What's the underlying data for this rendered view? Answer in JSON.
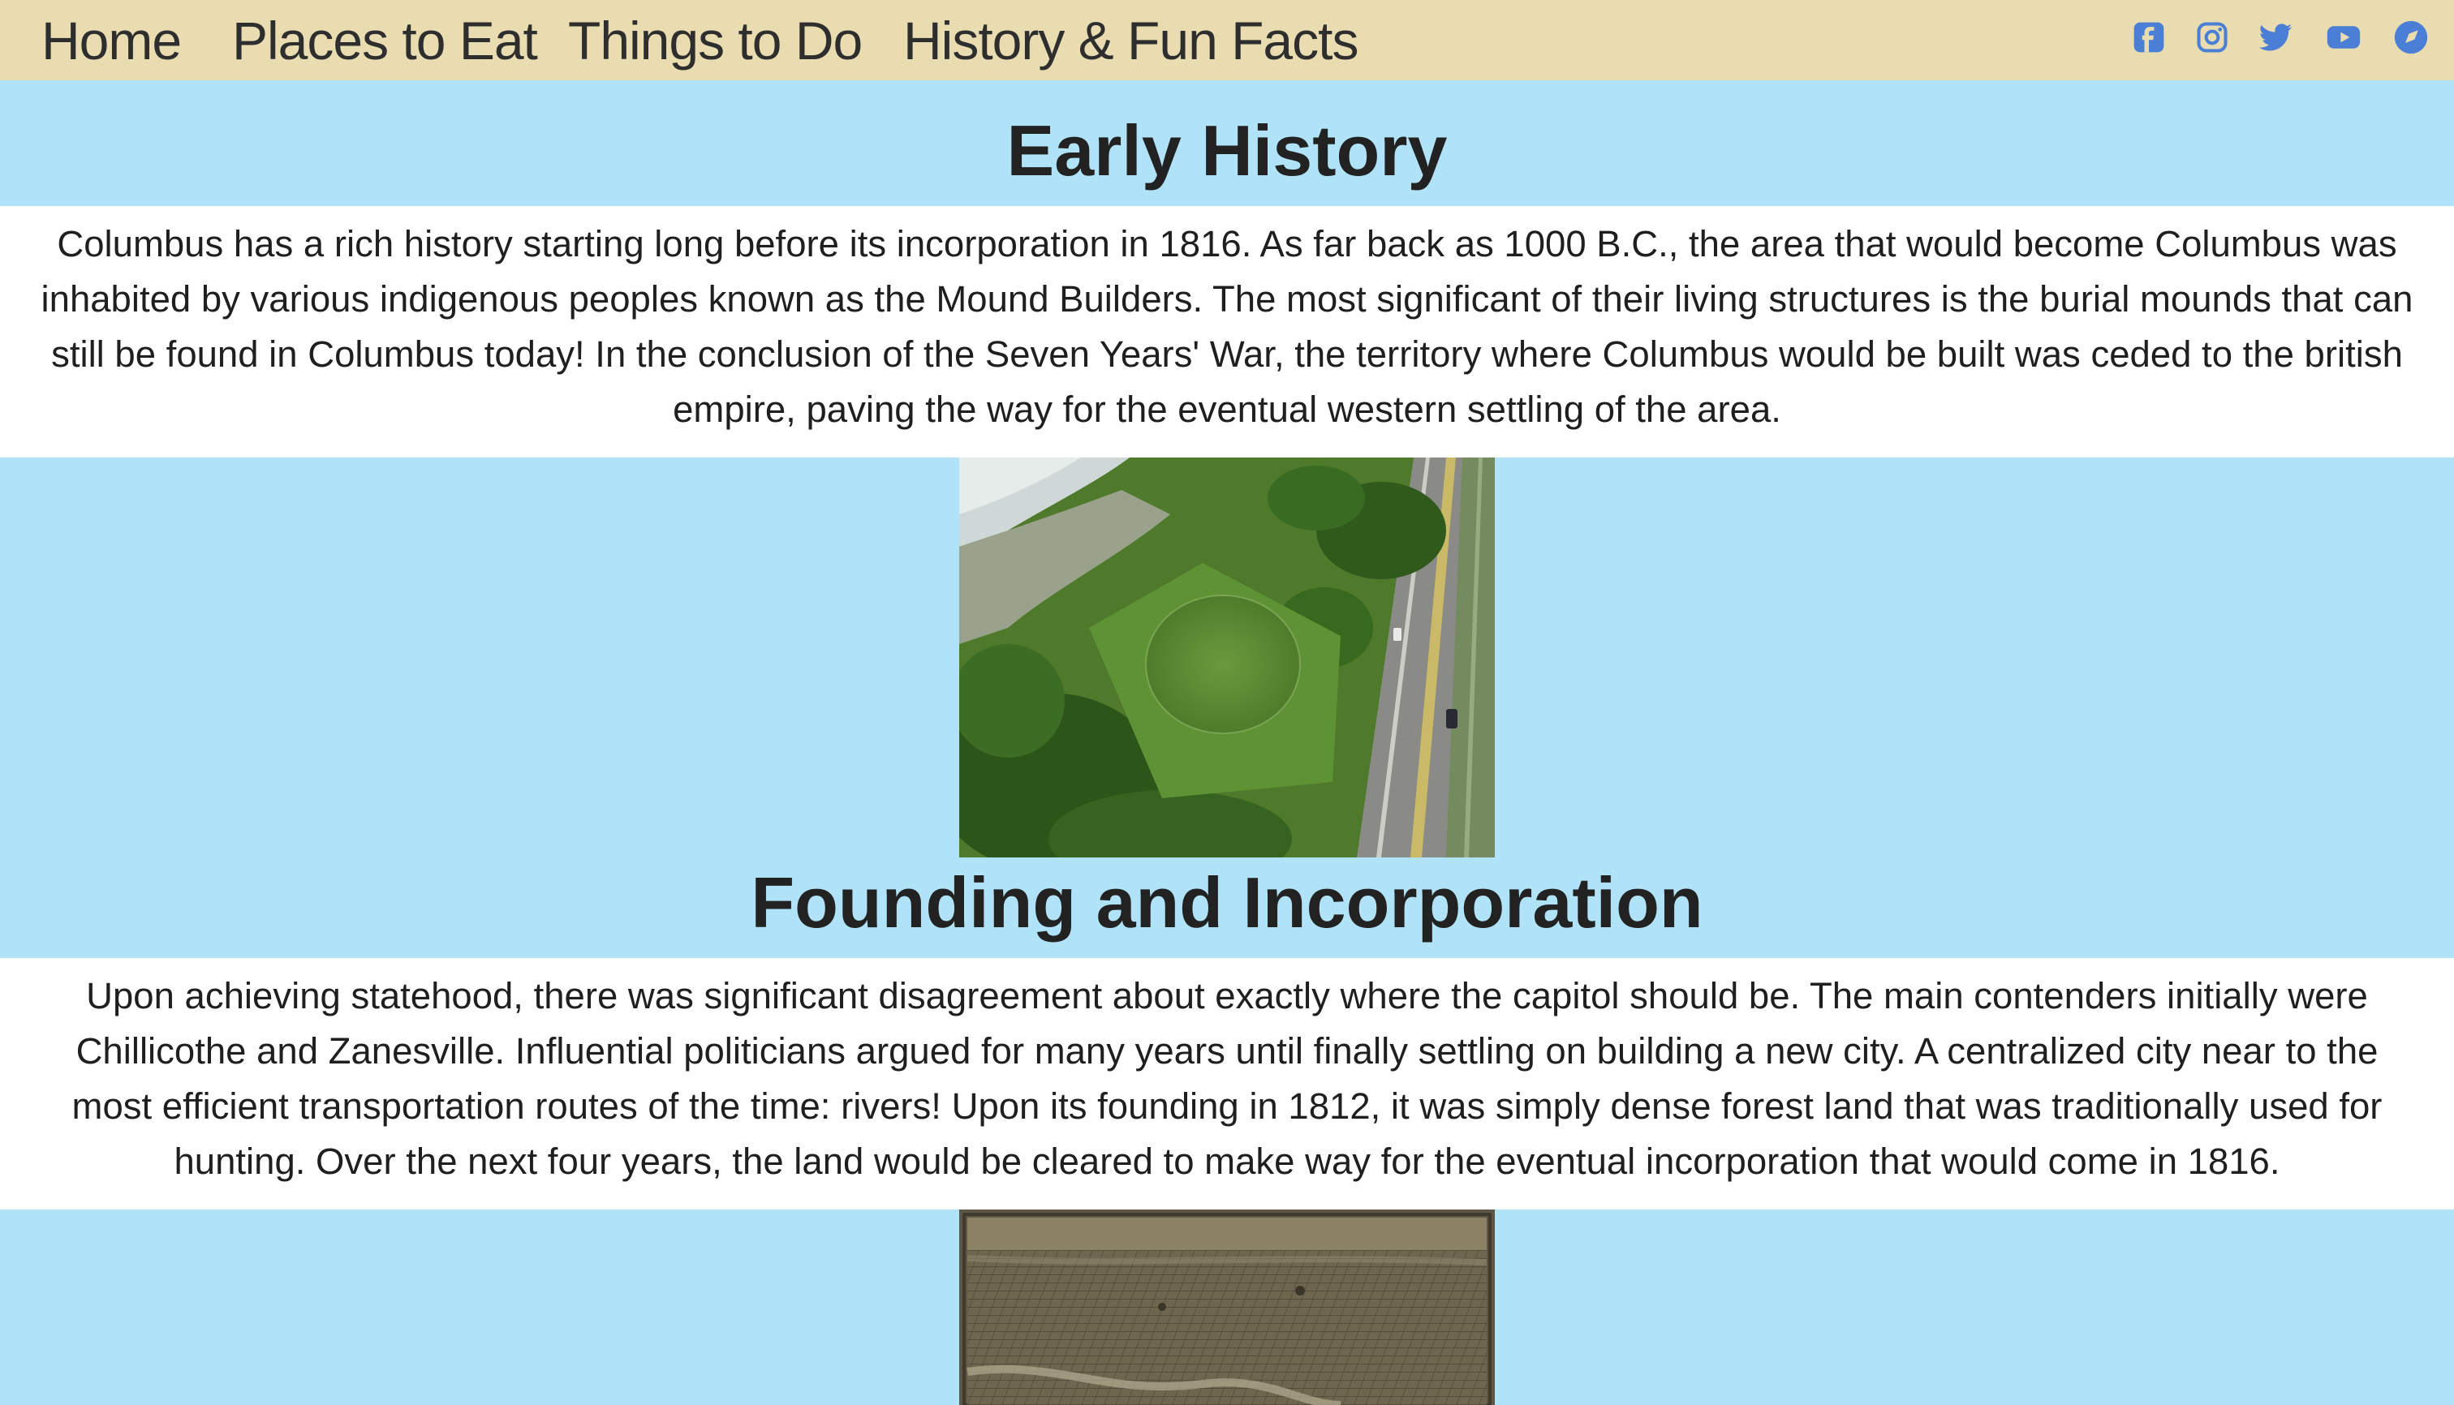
{
  "nav": {
    "links": [
      {
        "label": "Home"
      },
      {
        "label": "Places to Eat"
      },
      {
        "label": "Things to Do"
      },
      {
        "label": "History & Fun Facts"
      }
    ],
    "social_icons": [
      {
        "icon": "facebook-icon"
      },
      {
        "icon": "instagram-icon"
      },
      {
        "icon": "twitter-icon"
      },
      {
        "icon": "youtube-icon"
      },
      {
        "icon": "compass-icon"
      }
    ],
    "icon_color": "#4b7fd6"
  },
  "sections": [
    {
      "heading": "Early History",
      "body": "Columbus has a rich history starting long before its incorporation in 1816. As far back as 1000 B.C., the area that would become Columbus was inhabited by various indigenous peoples known as the Mound Builders. The most significant of their living structures is the burial mounds that can still be found in Columbus today! In the conclusion of the Seven Years' War, the territory where Columbus would be built was ceded to the british empire, paving the way for the eventual western settling of the area.",
      "image": "aerial-mound-photo"
    },
    {
      "heading": "Founding and Incorporation",
      "body": "Upon achieving statehood, there was significant disagreement about exactly where the capitol should be. The main contenders initially were Chillicothe and Zanesville. Influential politicians argued for many years until finally settling on building a new city. A centralized city near to the most efficient transportation routes of the time: rivers! Upon its founding in 1812, it was simply dense forest land that was traditionally used for hunting. Over the next four years, the land would be cleared to make way for the eventual incorporation that would come in 1816.",
      "image": "historic-city-map"
    }
  ],
  "colors": {
    "nav_background": "#e8dcb0",
    "page_background": "#b0e3f8",
    "text_band_background": "#ffffff"
  }
}
